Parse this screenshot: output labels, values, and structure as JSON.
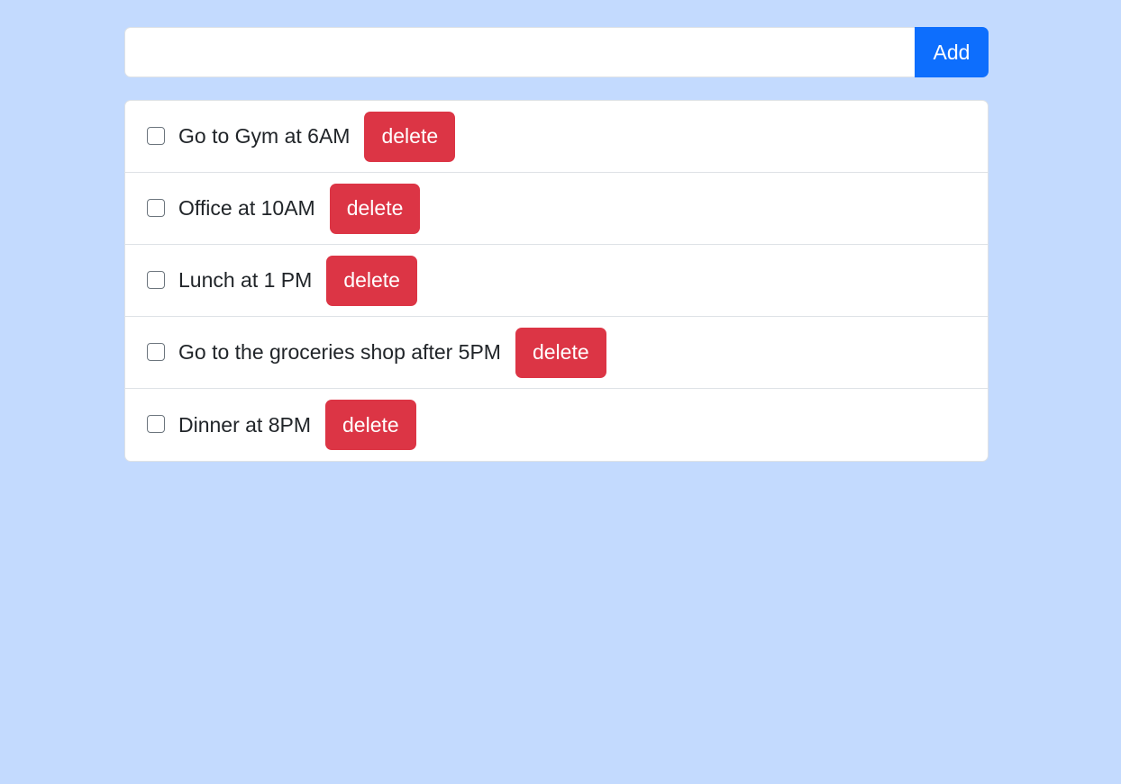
{
  "new_task": {
    "value": "",
    "placeholder": "",
    "add_label": "Add"
  },
  "tasks": [
    {
      "label": "Go to Gym at 6AM",
      "checked": false,
      "delete_label": "delete"
    },
    {
      "label": "Office at 10AM",
      "checked": false,
      "delete_label": "delete"
    },
    {
      "label": "Lunch at 1 PM",
      "checked": false,
      "delete_label": "delete"
    },
    {
      "label": "Go to the groceries shop after 5PM",
      "checked": false,
      "delete_label": "delete"
    },
    {
      "label": "Dinner at 8PM",
      "checked": false,
      "delete_label": "delete"
    }
  ],
  "colors": {
    "page_background": "#c3dafe",
    "add_button": "#0d6efd",
    "delete_button": "#dc3545"
  }
}
